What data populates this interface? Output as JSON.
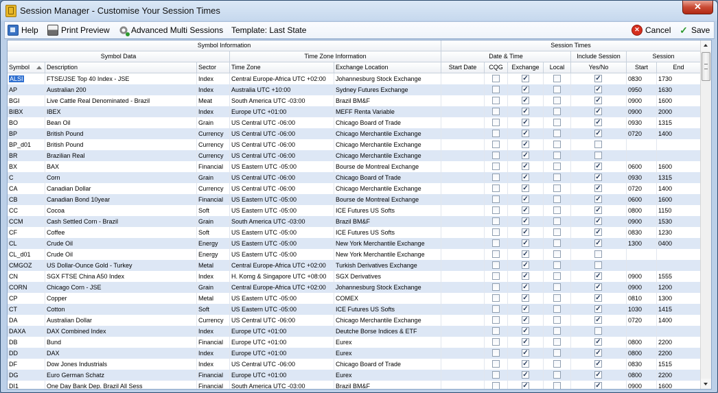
{
  "window": {
    "title": "Session Manager - Customise Your Session Times",
    "close_label": "✕"
  },
  "toolbar": {
    "help_label": "Help",
    "print_label": "Print Preview",
    "ams_label": "Advanced Multi Sessions",
    "template_label": "Template: Last State",
    "cancel_label": "Cancel",
    "save_label": "Save"
  },
  "headers": {
    "symbol_information": "Symbol Information",
    "session_times": "Session Times",
    "symbol_data": "Symbol Data",
    "time_zone_information": "Time Zone Information",
    "date_time": "Date & Time",
    "include_session": "Include Session",
    "session": "Session",
    "symbol": "Symbol",
    "description": "Description",
    "sector": "Sector",
    "time_zone": "Time Zone",
    "exchange_location": "Exchange Location",
    "start_date": "Start Date",
    "cqg": "CQG",
    "exchange": "Exchange",
    "local": "Local",
    "yes_no": "Yes/No",
    "start": "Start",
    "end": "End"
  },
  "rows": [
    {
      "symbol": "ALSI",
      "description": "FTSE/JSE Top 40 Index - JSE",
      "sector": "Index",
      "time_zone": "Central Europe-Africa UTC +02:00",
      "exchange_location": "Johannesburg Stock Exchange",
      "start_date": "",
      "cqg": false,
      "exchange": true,
      "local": false,
      "include": true,
      "start": "0830",
      "end": "1730",
      "selected": true
    },
    {
      "symbol": "AP",
      "description": "Australian 200",
      "sector": "Index",
      "time_zone": "Australia UTC +10:00",
      "exchange_location": "Sydney Futures Exchange",
      "start_date": "",
      "cqg": false,
      "exchange": true,
      "local": false,
      "include": true,
      "start": "0950",
      "end": "1630"
    },
    {
      "symbol": "BGI",
      "description": "Live Cattle Real Denominated - Brazil",
      "sector": "Meat",
      "time_zone": "South America UTC -03:00",
      "exchange_location": "Brazil BM&F",
      "start_date": "",
      "cqg": false,
      "exchange": true,
      "local": false,
      "include": true,
      "start": "0900",
      "end": "1600"
    },
    {
      "symbol": "BIBX",
      "description": "IBEX",
      "sector": "Index",
      "time_zone": "Europe UTC +01:00",
      "exchange_location": "MEFF Renta Variable",
      "start_date": "",
      "cqg": false,
      "exchange": true,
      "local": false,
      "include": true,
      "start": "0900",
      "end": "2000"
    },
    {
      "symbol": "BO",
      "description": "Bean Oil",
      "sector": "Grain",
      "time_zone": "US Central UTC -06:00",
      "exchange_location": "Chicago Board of Trade",
      "start_date": "",
      "cqg": false,
      "exchange": true,
      "local": false,
      "include": true,
      "start": "0930",
      "end": "1315"
    },
    {
      "symbol": "BP",
      "description": "British Pound",
      "sector": "Currency",
      "time_zone": "US Central UTC -06:00",
      "exchange_location": "Chicago Merchantile Exchange",
      "start_date": "",
      "cqg": false,
      "exchange": true,
      "local": false,
      "include": true,
      "start": "0720",
      "end": "1400"
    },
    {
      "symbol": "BP_d01",
      "description": "British Pound",
      "sector": "Currency",
      "time_zone": "US Central UTC -06:00",
      "exchange_location": "Chicago Merchantile Exchange",
      "start_date": "",
      "cqg": false,
      "exchange": true,
      "local": false,
      "include": false,
      "start": "",
      "end": ""
    },
    {
      "symbol": "BR",
      "description": "Brazilian Real",
      "sector": "Currency",
      "time_zone": "US Central UTC -06:00",
      "exchange_location": "Chicago Merchantile Exchange",
      "start_date": "",
      "cqg": false,
      "exchange": true,
      "local": false,
      "include": false,
      "start": "",
      "end": ""
    },
    {
      "symbol": "BX",
      "description": "BAX",
      "sector": "Financial",
      "time_zone": "US Eastern UTC -05:00",
      "exchange_location": "Bourse de Montreal Exchange",
      "start_date": "",
      "cqg": false,
      "exchange": true,
      "local": false,
      "include": true,
      "start": "0600",
      "end": "1600"
    },
    {
      "symbol": "C",
      "description": "Corn",
      "sector": "Grain",
      "time_zone": "US Central UTC -06:00",
      "exchange_location": "Chicago Board of Trade",
      "start_date": "",
      "cqg": false,
      "exchange": true,
      "local": false,
      "include": true,
      "start": "0930",
      "end": "1315"
    },
    {
      "symbol": "CA",
      "description": "Canadian Dollar",
      "sector": "Currency",
      "time_zone": "US Central UTC -06:00",
      "exchange_location": "Chicago Merchantile Exchange",
      "start_date": "",
      "cqg": false,
      "exchange": true,
      "local": false,
      "include": true,
      "start": "0720",
      "end": "1400"
    },
    {
      "symbol": "CB",
      "description": "Canadian Bond 10year",
      "sector": "Financial",
      "time_zone": "US Eastern UTC -05:00",
      "exchange_location": "Bourse de Montreal Exchange",
      "start_date": "",
      "cqg": false,
      "exchange": true,
      "local": false,
      "include": true,
      "start": "0600",
      "end": "1600"
    },
    {
      "symbol": "CC",
      "description": "Cocoa",
      "sector": "Soft",
      "time_zone": "US Eastern UTC -05:00",
      "exchange_location": "ICE Futures US Softs",
      "start_date": "",
      "cqg": false,
      "exchange": true,
      "local": false,
      "include": true,
      "start": "0800",
      "end": "1150"
    },
    {
      "symbol": "CCM",
      "description": "Cash Settled Corn - Brazil",
      "sector": "Grain",
      "time_zone": "South America UTC -03:00",
      "exchange_location": "Brazil BM&F",
      "start_date": "",
      "cqg": false,
      "exchange": true,
      "local": false,
      "include": true,
      "start": "0900",
      "end": "1530"
    },
    {
      "symbol": "CF",
      "description": "Coffee",
      "sector": "Soft",
      "time_zone": "US Eastern UTC -05:00",
      "exchange_location": "ICE Futures US Softs",
      "start_date": "",
      "cqg": false,
      "exchange": true,
      "local": false,
      "include": true,
      "start": "0830",
      "end": "1230"
    },
    {
      "symbol": "CL",
      "description": "Crude Oil",
      "sector": "Energy",
      "time_zone": "US Eastern UTC -05:00",
      "exchange_location": "New York Merchantile Exchange",
      "start_date": "",
      "cqg": false,
      "exchange": true,
      "local": false,
      "include": true,
      "start": "1300",
      "end": "0400"
    },
    {
      "symbol": "CL_d01",
      "description": "Crude Oil",
      "sector": "Energy",
      "time_zone": "US Eastern UTC -05:00",
      "exchange_location": "New York Merchantile Exchange",
      "start_date": "",
      "cqg": false,
      "exchange": true,
      "local": false,
      "include": false,
      "start": "",
      "end": ""
    },
    {
      "symbol": "CMGOZ",
      "description": "US Dollar-Ounce Gold - Turkey",
      "sector": "Metal",
      "time_zone": "Central Europe-Africa UTC +02:00",
      "exchange_location": "Turkish Derivatives Exchange",
      "start_date": "",
      "cqg": false,
      "exchange": true,
      "local": false,
      "include": false,
      "start": "",
      "end": ""
    },
    {
      "symbol": "CN",
      "description": "SGX FTSE China A50 Index",
      "sector": "Index",
      "time_zone": "H. Komg & Singapore UTC +08:00",
      "exchange_location": "SGX Derivatives",
      "start_date": "",
      "cqg": false,
      "exchange": true,
      "local": false,
      "include": true,
      "start": "0900",
      "end": "1555"
    },
    {
      "symbol": "CORN",
      "description": "Chicago Corn - JSE",
      "sector": "Grain",
      "time_zone": "Central Europe-Africa UTC +02:00",
      "exchange_location": "Johannesburg Stock Exchange",
      "start_date": "",
      "cqg": false,
      "exchange": true,
      "local": false,
      "include": true,
      "start": "0900",
      "end": "1200"
    },
    {
      "symbol": "CP",
      "description": "Copper",
      "sector": "Metal",
      "time_zone": "US Eastern UTC -05:00",
      "exchange_location": "COMEX",
      "start_date": "",
      "cqg": false,
      "exchange": true,
      "local": false,
      "include": true,
      "start": "0810",
      "end": "1300"
    },
    {
      "symbol": "CT",
      "description": "Cotton",
      "sector": "Soft",
      "time_zone": "US Eastern UTC -05:00",
      "exchange_location": "ICE Futures US Softs",
      "start_date": "",
      "cqg": false,
      "exchange": true,
      "local": false,
      "include": true,
      "start": "1030",
      "end": "1415"
    },
    {
      "symbol": "DA",
      "description": "Australian Dollar",
      "sector": "Currency",
      "time_zone": "US Central UTC -06:00",
      "exchange_location": "Chicago Merchantile Exchange",
      "start_date": "",
      "cqg": false,
      "exchange": true,
      "local": false,
      "include": true,
      "start": "0720",
      "end": "1400"
    },
    {
      "symbol": "DAXA",
      "description": "DAX Combined Index",
      "sector": "Index",
      "time_zone": "Europe UTC +01:00",
      "exchange_location": "Deutche Borse Indices & ETF",
      "start_date": "",
      "cqg": false,
      "exchange": true,
      "local": false,
      "include": false,
      "start": "",
      "end": ""
    },
    {
      "symbol": "DB",
      "description": "Bund",
      "sector": "Financial",
      "time_zone": "Europe UTC +01:00",
      "exchange_location": "Eurex",
      "start_date": "",
      "cqg": false,
      "exchange": true,
      "local": false,
      "include": true,
      "start": "0800",
      "end": "2200"
    },
    {
      "symbol": "DD",
      "description": "DAX",
      "sector": "Index",
      "time_zone": "Europe UTC +01:00",
      "exchange_location": "Eurex",
      "start_date": "",
      "cqg": false,
      "exchange": true,
      "local": false,
      "include": true,
      "start": "0800",
      "end": "2200"
    },
    {
      "symbol": "DF",
      "description": "Dow Jones Industrials",
      "sector": "Index",
      "time_zone": "US Central UTC -06:00",
      "exchange_location": "Chicago Board of Trade",
      "start_date": "",
      "cqg": false,
      "exchange": true,
      "local": false,
      "include": true,
      "start": "0830",
      "end": "1515"
    },
    {
      "symbol": "DG",
      "description": "Euro German Schatz",
      "sector": "Financial",
      "time_zone": "Europe UTC +01:00",
      "exchange_location": "Eurex",
      "start_date": "",
      "cqg": false,
      "exchange": true,
      "local": false,
      "include": true,
      "start": "0800",
      "end": "2200"
    },
    {
      "symbol": "DI1",
      "description": "One Day Bank Dep. Brazil All Sess",
      "sector": "Financial",
      "time_zone": "South America UTC -03:00",
      "exchange_location": "Brazil BM&F",
      "start_date": "",
      "cqg": false,
      "exchange": true,
      "local": false,
      "include": true,
      "start": "0900",
      "end": "1600"
    }
  ]
}
